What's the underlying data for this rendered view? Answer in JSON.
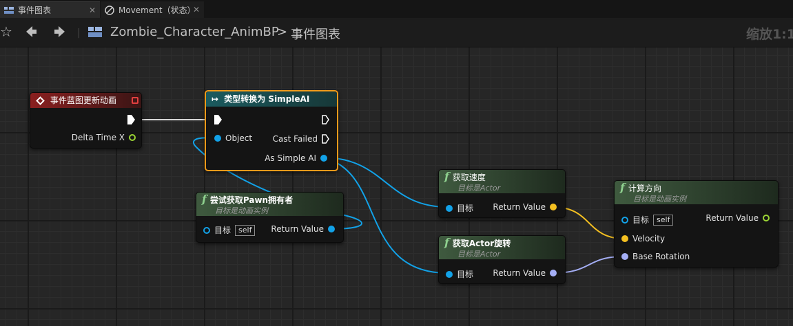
{
  "tabs": [
    {
      "label": "事件图表",
      "close": "✕",
      "icon": "graph-icon"
    },
    {
      "label": "Movement（状态）",
      "close": "✕",
      "icon": "state-icon"
    }
  ],
  "breadcrumb": {
    "blueprint": "Zombie_Character_AnimBP",
    "separator": ">",
    "graph": "事件图表"
  },
  "zoom_label": "缩放1:1",
  "nodes": {
    "event": {
      "title": "事件蓝图更新动画",
      "pin_delta": "Delta Time X"
    },
    "cast": {
      "title": "类型转换为 SimpleAI",
      "pin_object": "Object",
      "pin_failed": "Cast Failed",
      "pin_as": "As Simple AI"
    },
    "try_pawn": {
      "title": "尝试获取Pawn拥有者",
      "subtitle": "目标是动画实例",
      "pin_target": "目标",
      "self_label": "self",
      "pin_return": "Return Value"
    },
    "get_velocity": {
      "title": "获取速度",
      "subtitle": "目标是Actor",
      "pin_target": "目标",
      "pin_return": "Return Value"
    },
    "get_rotation": {
      "title": "获取Actor旋转",
      "subtitle": "目标是Actor",
      "pin_target": "目标",
      "pin_return": "Return Value"
    },
    "calc_direction": {
      "title": "计算方向",
      "subtitle": "目标是动画实例",
      "pin_target": "目标",
      "self_label": "self",
      "pin_return": "Return Value",
      "pin_velocity": "Velocity",
      "pin_base_rotation": "Base Rotation"
    }
  },
  "colors": {
    "object_pin": "#12a2e8",
    "float_pin": "#9ad334",
    "vector_pin": "#f5c021",
    "rotator_pin": "#a4aef5",
    "event_header": "#8a1f1f",
    "cast_header": "#1b5b5f",
    "function_header": "#3f5a3f",
    "selection": "#f09a1a"
  }
}
